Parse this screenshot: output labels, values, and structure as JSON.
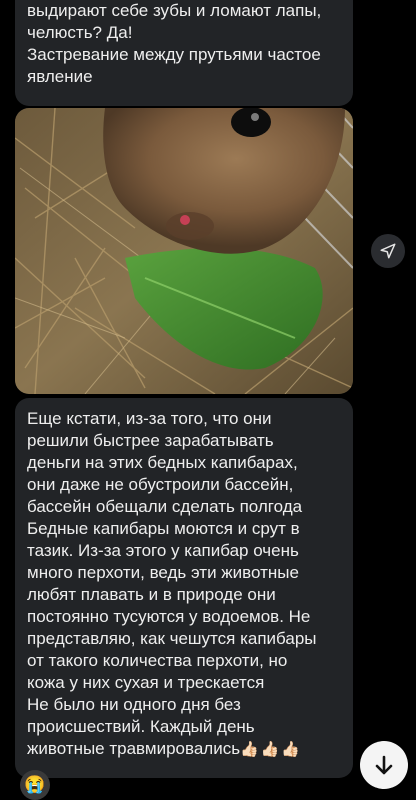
{
  "messages": {
    "top_lines": [
      "выдирают себе зубы и ломают лапы,",
      "челюсть? Да!",
      "Застревание между прутьями частое",
      "явление"
    ],
    "photo_alt": "capybara-eating-leaf-photo",
    "bottom_lines": [
      "Еще кстати, из-за того, что они",
      "решили быстрее зарабатывать",
      "деньги на этих бедных капибарах,",
      "они даже не обустроили бассейн,",
      "бассейн обещали сделать полгода",
      "Бедные капибары моются и срут в",
      "тазик. Из-за этого у капибар очень",
      "много перхоти, ведь эти животные",
      "любят плавать и в природе они",
      "постоянно тусуются у водоемов. Не",
      "представляю, как чешутся капибары",
      "от такого количества перхоти, но",
      "кожа у них сухая и трескается",
      "Не было ни одного дня без",
      "происшествий. Каждый день",
      "животные травмировались"
    ],
    "bottom_emoji": "👍🏻👍🏻👍🏻"
  },
  "icons": {
    "forward": "forward-arrow-icon",
    "scroll_down": "arrow-down-icon",
    "avatar_emoji": "😭"
  },
  "colors": {
    "background": "#000000",
    "bubble": "#222427",
    "text": "#eeeeee",
    "scroll_button": "#f4f4f4"
  }
}
